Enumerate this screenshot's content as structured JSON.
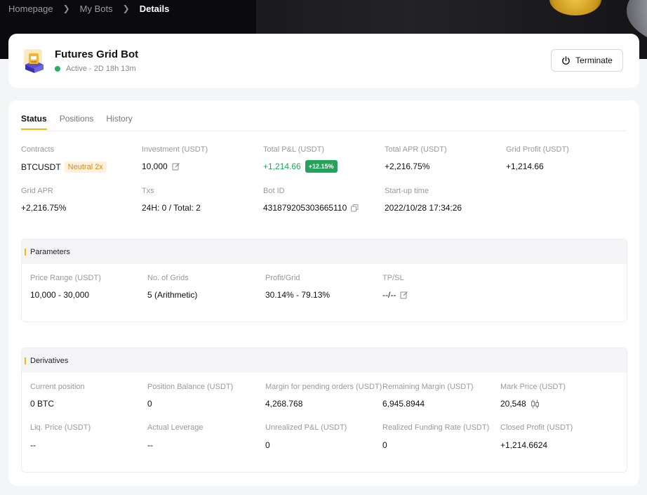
{
  "breadcrumb": {
    "home": "Homepage",
    "bots": "My Bots",
    "current": "Details"
  },
  "header": {
    "title": "Futures Grid Bot",
    "status": "Active - 2D 18h 13m",
    "terminate_label": "Terminate"
  },
  "tabs": [
    {
      "label": "Status",
      "active": true
    },
    {
      "label": "Positions",
      "active": false
    },
    {
      "label": "History",
      "active": false
    }
  ],
  "status": {
    "contracts": {
      "label": "Contracts",
      "value": "BTCUSDT",
      "badge": "Neutral 2x"
    },
    "investment": {
      "label": "Investment (USDT)",
      "value": "10,000"
    },
    "total_pnl": {
      "label": "Total P&L (USDT)",
      "value": "+1,214.66",
      "badge": "+12.15%"
    },
    "total_apr": {
      "label": "Total APR (USDT)",
      "value": "+2,216.75%"
    },
    "grid_profit": {
      "label": "Grid Profit (USDT)",
      "value": "+1,214.66"
    },
    "grid_apr": {
      "label": "Grid APR",
      "value": "+2,216.75%"
    },
    "txs": {
      "label": "Txs",
      "value": "24H: 0 / Total: 2"
    },
    "bot_id": {
      "label": "Bot ID",
      "value": "431879205303665110"
    },
    "startup": {
      "label": "Start-up time",
      "value": "2022/10/28 17:34:26"
    }
  },
  "parameters": {
    "title": "Parameters",
    "price_range": {
      "label": "Price Range (USDT)",
      "value": "10,000 - 30,000"
    },
    "grids": {
      "label": "No. of Grids",
      "value": "5 (Arithmetic)"
    },
    "profit_grid": {
      "label": "Profit/Grid",
      "value": "30.14% - 79.13%"
    },
    "tpsl": {
      "label": "TP/SL",
      "value": "--/--"
    }
  },
  "derivatives": {
    "title": "Derivatives",
    "current_position": {
      "label": "Current position",
      "value": "0 BTC"
    },
    "position_balance": {
      "label": "Position Balance (USDT)",
      "value": "0"
    },
    "margin_pending": {
      "label": "Margin for pending orders (USDT)",
      "value": "4,268.768"
    },
    "remaining_margin": {
      "label": "Remaining Margin (USDT)",
      "value": "6,945.8944"
    },
    "mark_price": {
      "label": "Mark Price (USDT)",
      "value": "20,548"
    },
    "liq_price": {
      "label": "Liq. Price (USDT)",
      "value": "--"
    },
    "actual_leverage": {
      "label": "Actual Leverage",
      "value": "--"
    },
    "unrealized_pnl": {
      "label": "Unrealized P&L (USDT)",
      "value": "0"
    },
    "funding_rate": {
      "label": "Realized Funding Rate (USDT)",
      "value": "0"
    },
    "closed_profit": {
      "label": "Closed Profit (USDT)",
      "value": "+1,214.6624"
    }
  },
  "colors": {
    "accent": "#f0b90b",
    "positive": "#22a55a",
    "status_active": "#22b35a",
    "badge_bg": "#fdf0dc"
  },
  "icons": [
    "chevron-right-icon",
    "power-icon",
    "edit-icon",
    "copy-icon",
    "candlestick-icon",
    "bot-logo-icon"
  ]
}
